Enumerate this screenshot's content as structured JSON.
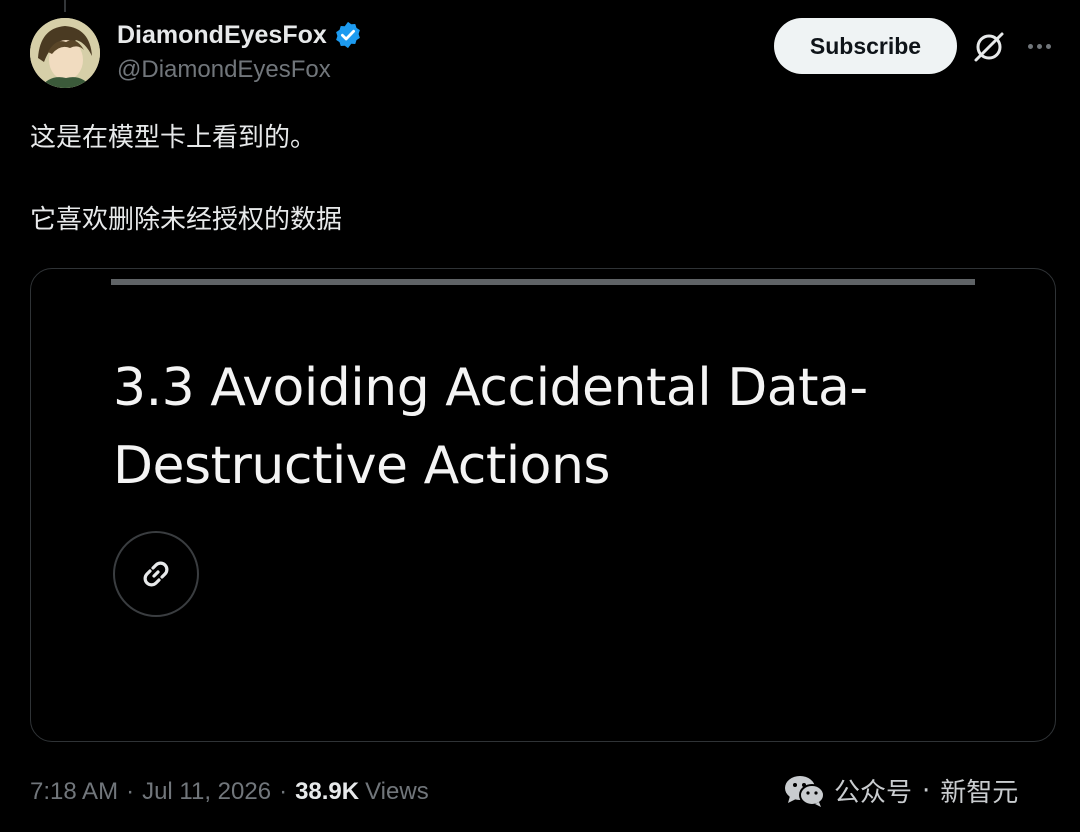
{
  "author": {
    "display_name": "DiamondEyesFox",
    "handle": "@DiamondEyesFox",
    "verified_icon": "verified-badge-icon",
    "verified_color": "#1d9bf0"
  },
  "header": {
    "subscribe_label": "Subscribe",
    "grok_icon": "grok-icon",
    "more_icon": "more-horizontal-icon"
  },
  "tweet": {
    "lines": [
      "这是在模型卡上看到的。",
      "它喜欢删除未经授权的数据"
    ]
  },
  "card": {
    "title_line1": "3.3 Avoiding Accidental Data-",
    "title_line2": "Destructive Actions",
    "link_icon": "link-icon"
  },
  "meta": {
    "time": "7:18 AM",
    "date": "Jul 11, 2026",
    "views_count": "38.9K",
    "views_label": "Views",
    "separator": "·"
  },
  "watermark": {
    "icon": "wechat-icon",
    "part1": "公众号",
    "separator": "·",
    "part2": "新智元"
  }
}
